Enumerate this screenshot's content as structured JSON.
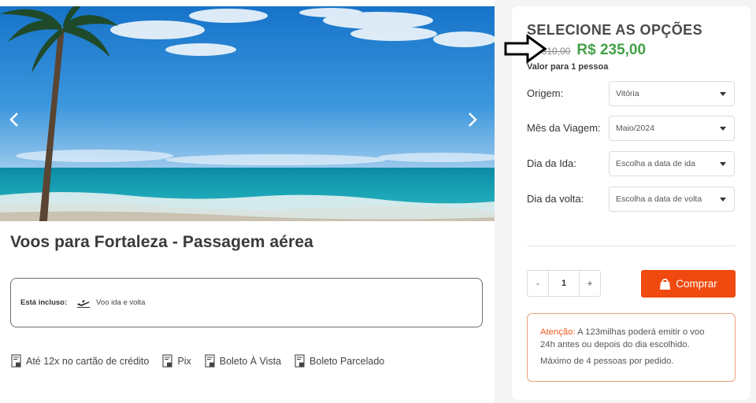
{
  "product": {
    "title": "Voos para Fortaleza - Passagem aérea",
    "included_label": "Está incluso:",
    "included_items": [
      "Voo ida e volta"
    ]
  },
  "carousel": {
    "prev_icon": "chevron-left-icon",
    "next_icon": "chevron-right-icon"
  },
  "payments": [
    {
      "label": "Até 12x no cartão de crédito",
      "icon": "payment-receipt-icon"
    },
    {
      "label": "Pix",
      "icon": "payment-receipt-icon"
    },
    {
      "label": "Boleto À Vista",
      "icon": "payment-receipt-icon"
    },
    {
      "label": "Boleto Parcelado",
      "icon": "payment-receipt-icon"
    }
  ],
  "options": {
    "title": "SELECIONE AS OPÇÕES",
    "old_price": "R$ 310,00",
    "price": "R$ 235,00",
    "per_person": "Valor para 1 pessoa",
    "fields": [
      {
        "label": "Origem:",
        "value": "Vitória"
      },
      {
        "label": "Mês da Viagem:",
        "value": "Maio/2024"
      },
      {
        "label": "Dia da Ida:",
        "value": "Escolha a data de ida"
      },
      {
        "label": "Dia da volta:",
        "value": "Escolha a data de volta"
      }
    ],
    "quantity": "1",
    "minus": "-",
    "plus": "+",
    "buy_label": "Comprar"
  },
  "notice": {
    "strong": "Atenção:",
    "text_line1": " A 123milhas poderá emitir o voo",
    "text_line2": "24h antes ou depois do dia escolhido.",
    "text_line3": "Máximo de 4 pessoas por pedido."
  },
  "colors": {
    "price_green": "#43a047",
    "buy_orange": "#f04a10",
    "notice_orange": "#ef5a1e"
  }
}
